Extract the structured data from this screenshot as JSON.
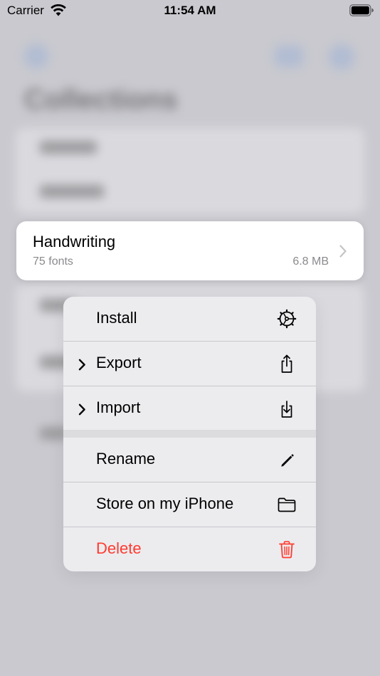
{
  "status_bar": {
    "carrier": "Carrier",
    "time": "11:54 AM"
  },
  "background_app": {
    "title": "Collections"
  },
  "collection_card": {
    "title": "Handwriting",
    "font_count": "75 fonts",
    "size": "6.8 MB"
  },
  "context_menu": {
    "items": [
      {
        "label": "Install",
        "icon": "gear-icon",
        "has_submenu": false,
        "destructive": false
      },
      {
        "label": "Export",
        "icon": "share-icon",
        "has_submenu": true,
        "destructive": false
      },
      {
        "label": "Import",
        "icon": "import-tray-icon",
        "has_submenu": true,
        "destructive": false
      },
      {
        "label": "Rename",
        "icon": "pencil-icon",
        "has_submenu": false,
        "destructive": false
      },
      {
        "label": "Store on my iPhone",
        "icon": "folder-icon",
        "has_submenu": false,
        "destructive": false
      },
      {
        "label": "Delete",
        "icon": "trash-icon",
        "has_submenu": false,
        "destructive": true
      }
    ]
  },
  "colors": {
    "destructive": "#ff3b30",
    "secondary_text": "#8a8a8e",
    "menu_background": "#ececef",
    "dimmed_background": "#c9c9cf"
  }
}
